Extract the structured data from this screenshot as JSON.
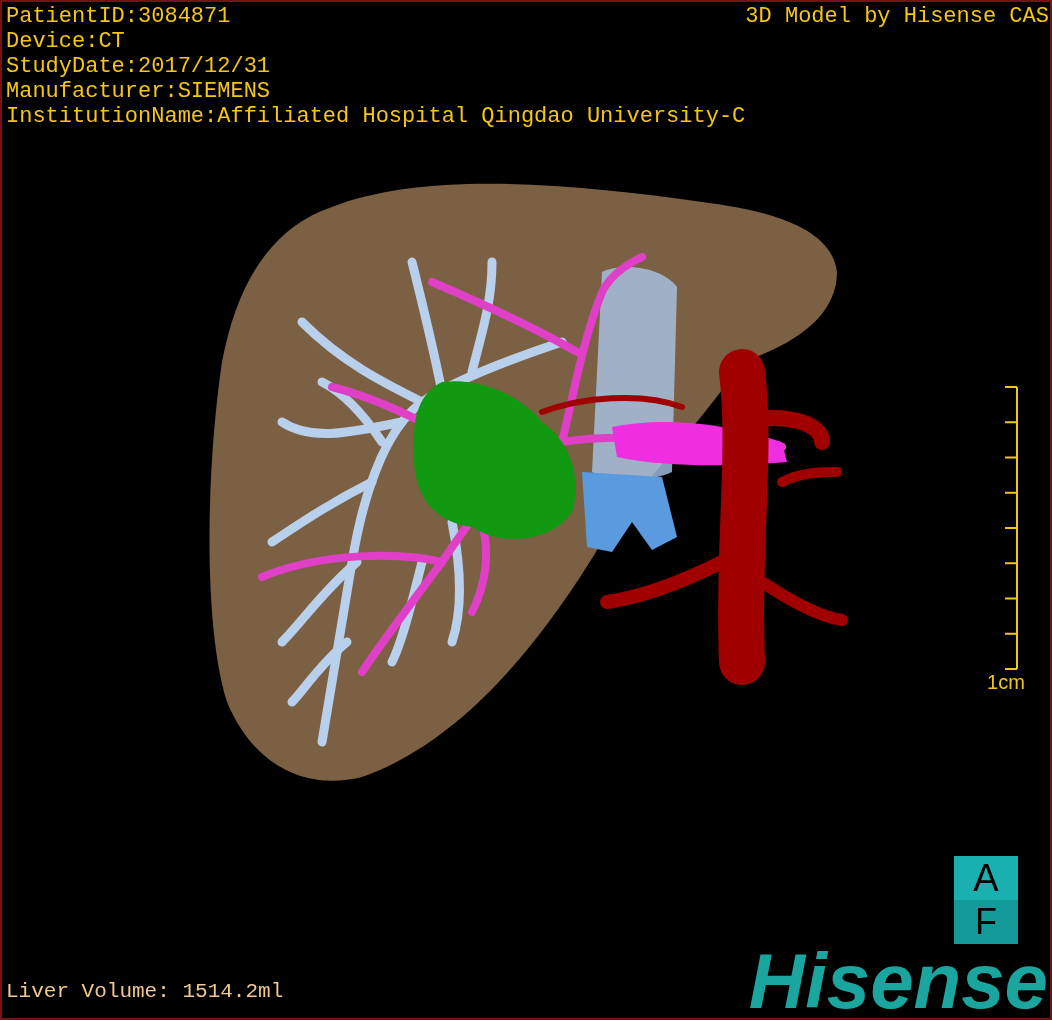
{
  "info_lines": [
    "PatientID:3084871",
    "Device:CT",
    "StudyDate:2017/12/31",
    "Manufacturer:SIEMENS",
    "InstitutionName:Affiliated Hospital Qingdao University-C"
  ],
  "title": "3D Model by Hisense CAS",
  "scale_bar": {
    "label": "1cm"
  },
  "orientation_cube": {
    "top": "A",
    "bottom": "F"
  },
  "liver_volume": "Liver Volume: 1514.2ml",
  "logo": "Hisense"
}
